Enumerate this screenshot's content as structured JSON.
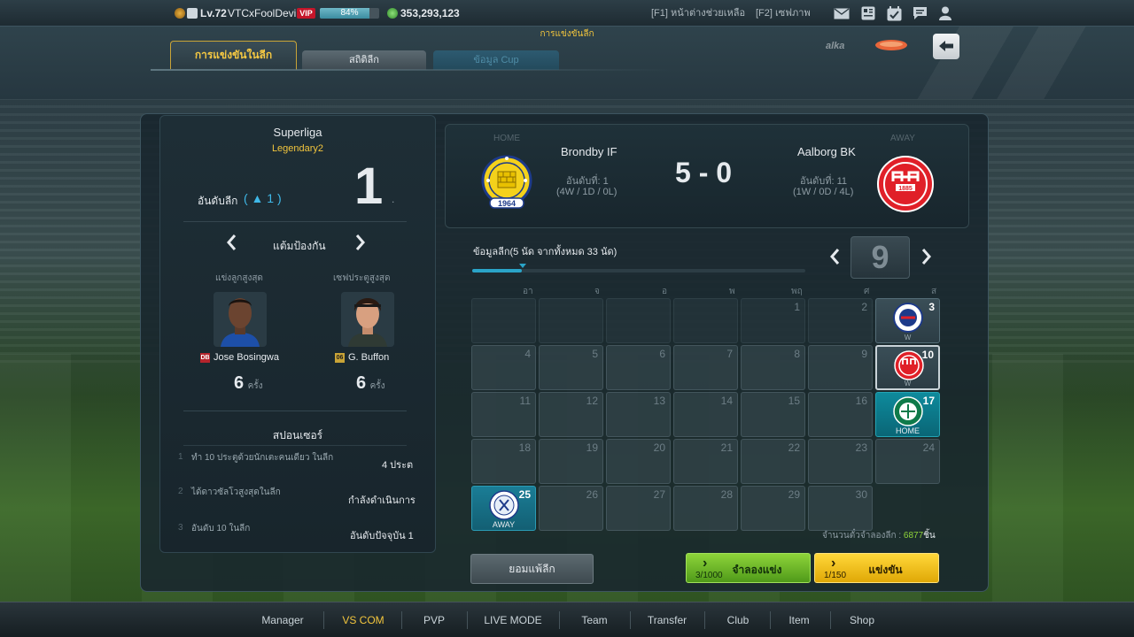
{
  "header": {
    "level": "Lv.72",
    "username": "VTCxFoolDevil",
    "vip": "VIP",
    "exp_percent": 84,
    "exp_label": "84%",
    "coins": "353,293,123",
    "help_link": "[F1] หน้าต่างช่วยเหลือ",
    "screenshot_link": "[F2] เซฟภาพ"
  },
  "breadcrumb": "การแข่งขันลีก",
  "tabs": [
    {
      "label": "การแข่งขันในลีก"
    },
    {
      "label": "สถิติลีก"
    },
    {
      "label": "ข้อมูล Cup"
    }
  ],
  "league_panel": {
    "league_name": "Superliga",
    "division": "Legendary2",
    "rank_label": "อันดับลีก",
    "rank_change": "( ▲ 1 )",
    "rank": "1",
    "rank_suffix": ".",
    "category_label": "แต้มป้องกัน",
    "top_scorer_label": "แข่งลูกสูงสุด",
    "top_saver_label": "เซฟประตูสูงสุด",
    "scorer": {
      "badge": "DB",
      "name": "Jose Bosingwa",
      "count": "6",
      "unit": "ครั้ง"
    },
    "saver": {
      "badge": "06",
      "name": "G. Buffon",
      "count": "6",
      "unit": "ครั้ง"
    },
    "sponsor_title": "สปอนเซอร์",
    "sponsors": [
      {
        "index": "1",
        "title": "ทำ 10 ประตูด้วยนักเตะคนเดียว ในลีก",
        "status": "4 ประต"
      },
      {
        "index": "2",
        "title": "ได้ดาวซัลโวสูงสุดในลีก",
        "status": "กำลังดำเนินการ"
      },
      {
        "index": "3",
        "title": "อันดับ 10 ในลีก",
        "status": "อันดับปัจจุบัน 1"
      }
    ]
  },
  "match": {
    "home_label": "HOME",
    "away_label": "AWAY",
    "home_team": "Brondby IF",
    "away_team": "Aalborg BK",
    "home_rank": "อันดับที่: 1",
    "home_record": "(4W / 1D / 0L)",
    "away_rank": "อันดับที่: 11",
    "away_record": "(1W / 0D / 4L)",
    "score": "5 - 0",
    "home_crest_year": "1964",
    "away_crest_year": "1885"
  },
  "schedule": {
    "info": "ข้อมูลลีก(5 นัด จากทั้งหมด 33 นัด)",
    "progress": 0.15,
    "month": "9",
    "weekdays": [
      "อา",
      "จ",
      "อ",
      "พ",
      "พฤ",
      "ศ",
      "ส"
    ],
    "footer_label": "จำนวนตั๋วจำลองลีก :",
    "footer_value": "6877",
    "footer_unit": "ชิ้น",
    "match_cells": {
      "d3": {
        "day": "3",
        "tag": "W"
      },
      "d10": {
        "day": "10",
        "tag": "W"
      },
      "d17": {
        "day": "17",
        "tag": "HOME"
      },
      "d25": {
        "day": "25",
        "tag": "AWAY"
      }
    }
  },
  "buttons": {
    "forfeit": "ยอมแพ้ลีก",
    "simulate": "จำลองแข่ง",
    "simulate_count": "3/1000",
    "play": "แข่งขัน",
    "play_count": "1/150"
  },
  "nav": [
    "Manager",
    "VS COM",
    "PVP",
    "LIVE MODE",
    "Team",
    "Transfer",
    "Club",
    "Item",
    "Shop"
  ],
  "colors": {
    "accent": "#f2c53d",
    "home_cell": "#0e8a9c",
    "simulate": "#8ed43a",
    "play": "#ffd83a"
  }
}
